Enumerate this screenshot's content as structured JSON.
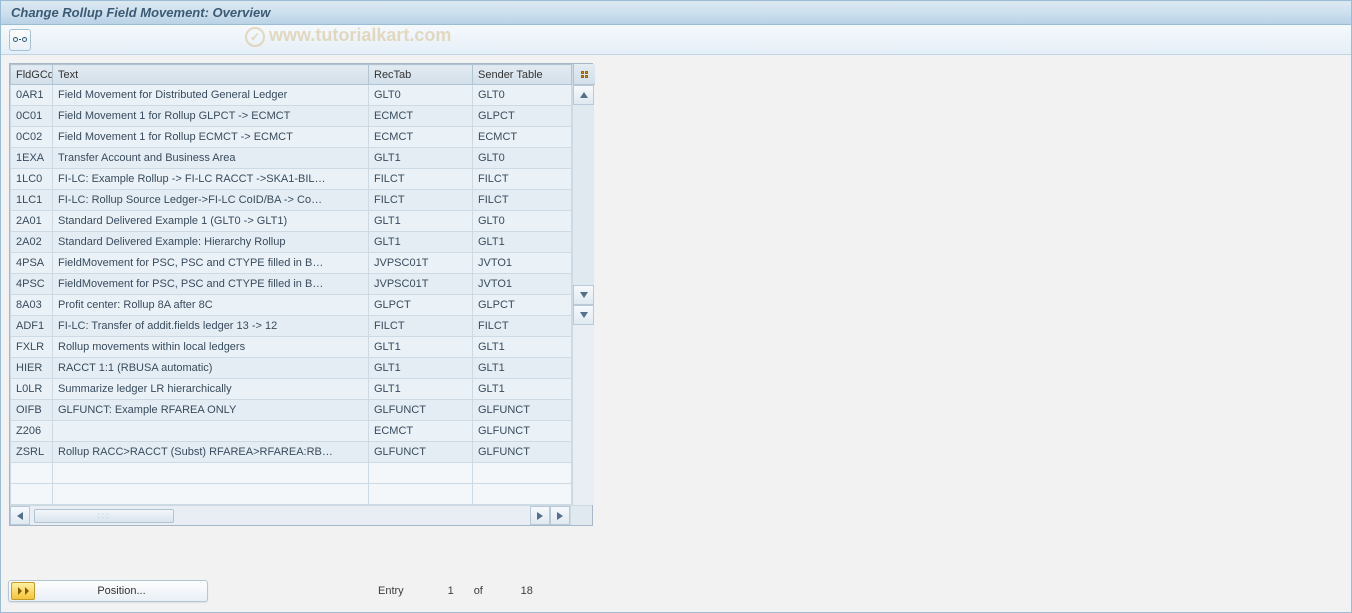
{
  "title": "Change Rollup Field Movement: Overview",
  "watermark": "www.tutorialkart.com",
  "columns": {
    "code": "FldGCd",
    "text": "Text",
    "rectab": "RecTab",
    "sender": "Sender Table"
  },
  "rows": [
    {
      "code": "0AR1",
      "text": "Field Movement for Distributed General Ledger",
      "rectab": "GLT0",
      "sender": "GLT0"
    },
    {
      "code": "0C01",
      "text": "Field Movement 1 for Rollup GLPCT -> ECMCT",
      "rectab": "ECMCT",
      "sender": "GLPCT"
    },
    {
      "code": "0C02",
      "text": "Field Movement 1 for Rollup ECMCT -> ECMCT",
      "rectab": "ECMCT",
      "sender": "ECMCT"
    },
    {
      "code": "1EXA",
      "text": "Transfer Account and Business Area",
      "rectab": "GLT1",
      "sender": "GLT0"
    },
    {
      "code": "1LC0",
      "text": "FI-LC: Example Rollup -> FI-LC RACCT ->SKA1-BIL…",
      "rectab": "FILCT",
      "sender": "FILCT"
    },
    {
      "code": "1LC1",
      "text": "FI-LC: Rollup Source Ledger->FI-LC CoID/BA -> Co…",
      "rectab": "FILCT",
      "sender": "FILCT"
    },
    {
      "code": "2A01",
      "text": "Standard Delivered Example 1 (GLT0 -> GLT1)",
      "rectab": "GLT1",
      "sender": "GLT0"
    },
    {
      "code": "2A02",
      "text": "Standard Delivered Example: Hierarchy Rollup",
      "rectab": "GLT1",
      "sender": "GLT1"
    },
    {
      "code": "4PSA",
      "text": "FieldMovement for PSC, PSC and CTYPE filled in B…",
      "rectab": "JVPSC01T",
      "sender": "JVTO1"
    },
    {
      "code": "4PSC",
      "text": "FieldMovement for PSC, PSC and CTYPE filled in B…",
      "rectab": "JVPSC01T",
      "sender": "JVTO1"
    },
    {
      "code": "8A03",
      "text": "Profit center: Rollup 8A after 8C",
      "rectab": "GLPCT",
      "sender": "GLPCT"
    },
    {
      "code": "ADF1",
      "text": "FI-LC: Transfer of addit.fields ledger 13 -> 12",
      "rectab": "FILCT",
      "sender": "FILCT"
    },
    {
      "code": "FXLR",
      "text": "Rollup movements within local ledgers",
      "rectab": "GLT1",
      "sender": "GLT1"
    },
    {
      "code": "HIER",
      "text": "RACCT 1:1 (RBUSA automatic)",
      "rectab": "GLT1",
      "sender": "GLT1"
    },
    {
      "code": "L0LR",
      "text": "Summarize ledger LR hierarchically",
      "rectab": "GLT1",
      "sender": "GLT1"
    },
    {
      "code": "OIFB",
      "text": "GLFUNCT: Example RFAREA ONLY",
      "rectab": "GLFUNCT",
      "sender": "GLFUNCT"
    },
    {
      "code": "Z206",
      "text": "",
      "rectab": "ECMCT",
      "sender": "GLFUNCT"
    },
    {
      "code": "ZSRL",
      "text": "Rollup RACC>RACCT (Subst) RFAREA>RFAREA:RB…",
      "rectab": "GLFUNCT",
      "sender": "GLFUNCT"
    }
  ],
  "footer": {
    "position_label": "Position...",
    "entry_label": "Entry",
    "entry_current": "1",
    "of_label": "of",
    "entry_total": "18"
  }
}
